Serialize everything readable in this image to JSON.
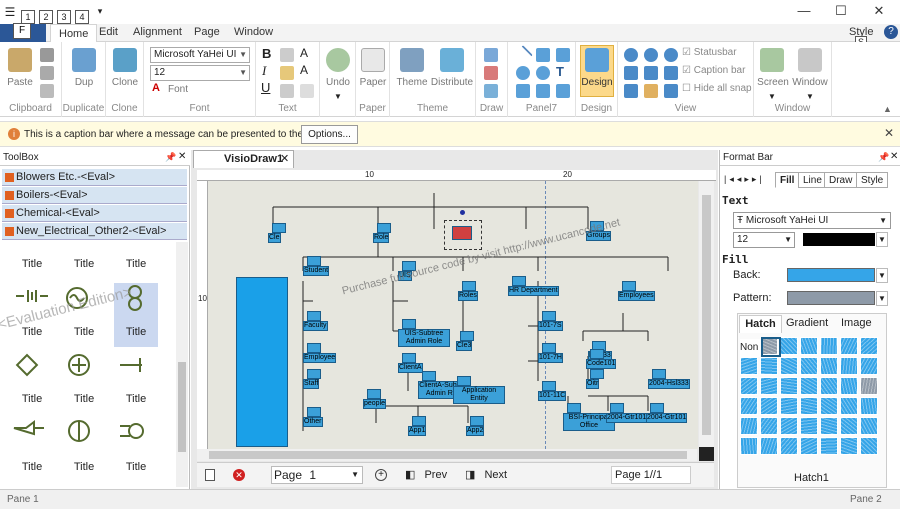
{
  "window": {
    "title_style": "Style",
    "minimize": "—",
    "maximize": "☐",
    "close": "✕"
  },
  "quick_access": [
    "1",
    "2",
    "3",
    "4"
  ],
  "keytips": {
    "file": "F",
    "style": "S",
    "help": "?"
  },
  "tabs": {
    "file": "",
    "home": "Home",
    "edit": "Edit",
    "alignment": "Alignment",
    "page": "Page",
    "window": "Window"
  },
  "ribbon": {
    "clipboard": {
      "label": "Clipboard",
      "paste": "Paste"
    },
    "duplicate": {
      "label": "Duplicate",
      "dup": "Dup"
    },
    "clone": {
      "label": "Clone",
      "clone": "Clone"
    },
    "font": {
      "label": "Font",
      "family": "Microsoft YaHei UI",
      "size": "12",
      "font_btn": "Font"
    },
    "text": {
      "label": "Text"
    },
    "undo": {
      "label": "",
      "undo": "Undo"
    },
    "paper": {
      "label": "Paper",
      "paper": "Paper"
    },
    "theme": {
      "label": "Theme",
      "theme": "Theme",
      "distribute": "Distribute"
    },
    "draw": {
      "label": "Draw"
    },
    "panel7": {
      "label": "Panel7"
    },
    "design": {
      "label": "Design",
      "design": "Design"
    },
    "view": {
      "label": "View",
      "statusbar": "Statusbar",
      "caption_bar": "Caption bar",
      "hide_snap": "Hide all snap"
    },
    "screen": {
      "label": "Window",
      "screen": "Screen",
      "window": "Window"
    }
  },
  "caption": {
    "message": "This is a caption bar where a message can be presented to the user.",
    "options": "Options..."
  },
  "toolbox": {
    "title": "ToolBox",
    "categories": [
      "Blowers Etc.-<Eval>",
      "Boilers-<Eval>",
      "Chemical-<Eval>",
      "New_Electrical_Other2-<Eval>"
    ],
    "shape_label": "Title",
    "watermark": "<Evaluation Edition>"
  },
  "document": {
    "tab": "VisioDraw1",
    "ruler_marks": [
      "10",
      "20"
    ],
    "ruler_v_marks": [
      "10"
    ],
    "watermark": "Purchase full source code by visit http://www.ucancode.net",
    "nodes": [
      "Student",
      "Faculty",
      "Employee",
      "Staff",
      "Other",
      "UIS",
      "UIS-Subtree Admin Role",
      "ClientA",
      "ClientA-Subtree Admin Role",
      "Application Entity",
      "Role",
      "Groups",
      "HR Department",
      "Employees",
      "101-7S",
      "101-7H",
      "101-11C",
      "BSI-Principal Office",
      "2004-Gtr101",
      "2004-Gtr101",
      "2004-Hsl333",
      "Hsl333",
      "Oitr",
      "Code101",
      "Cle",
      "people",
      "Roles",
      "Cle3",
      "App1",
      "App2"
    ],
    "paging": {
      "page_label": "Page",
      "page_value": "1",
      "prev": "Prev",
      "next": "Next",
      "indicator": "Page 1//1"
    }
  },
  "format_bar": {
    "title": "Format Bar",
    "tabs": [
      "Fill",
      "Line",
      "Draw",
      "Style"
    ],
    "text_section": "Text",
    "font": "Microsoft YaHei UI",
    "font_size": "12",
    "fill_section": "Fill",
    "back_label": "Back:",
    "pattern_label": "Pattern:",
    "subtabs": [
      "Hatch",
      "Gradient",
      "Image"
    ],
    "none_label": "Non",
    "hatch_label": "Hatch1",
    "colors": {
      "back": "#35a5e8",
      "pattern": "#8e9aa8",
      "text": "#000000"
    }
  },
  "status": {
    "pane1": "Pane 1",
    "pane2": "Pane 2"
  }
}
